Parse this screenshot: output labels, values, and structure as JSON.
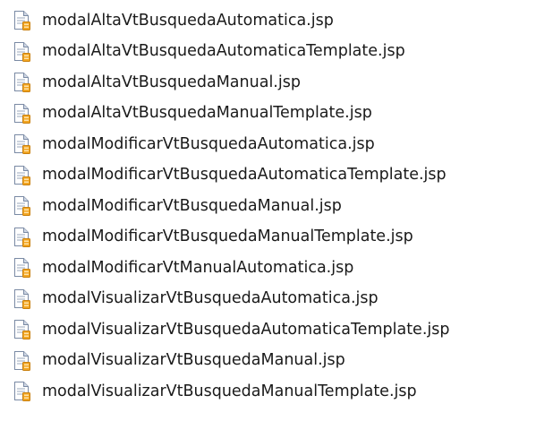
{
  "icon_name": "jsp-file-icon",
  "colors": {
    "text": "#1a1a1a",
    "page_fill": "#ffffff",
    "page_border": "#7a8aa4",
    "fold": "#cfd7e4",
    "lines": "#9aa7bb",
    "badge": "#f2a623",
    "badge_dark": "#c97f0c"
  },
  "files": [
    {
      "name": "modalAltaVtBusquedaAutomatica.jsp"
    },
    {
      "name": "modalAltaVtBusquedaAutomaticaTemplate.jsp"
    },
    {
      "name": "modalAltaVtBusquedaManual.jsp"
    },
    {
      "name": "modalAltaVtBusquedaManualTemplate.jsp"
    },
    {
      "name": "modalModificarVtBusquedaAutomatica.jsp"
    },
    {
      "name": "modalModificarVtBusquedaAutomaticaTemplate.jsp"
    },
    {
      "name": "modalModificarVtBusquedaManual.jsp"
    },
    {
      "name": "modalModificarVtBusquedaManualTemplate.jsp"
    },
    {
      "name": "modalModificarVtManualAutomatica.jsp"
    },
    {
      "name": "modalVisualizarVtBusquedaAutomatica.jsp"
    },
    {
      "name": "modalVisualizarVtBusquedaAutomaticaTemplate.jsp"
    },
    {
      "name": "modalVisualizarVtBusquedaManual.jsp"
    },
    {
      "name": "modalVisualizarVtBusquedaManualTemplate.jsp"
    }
  ]
}
